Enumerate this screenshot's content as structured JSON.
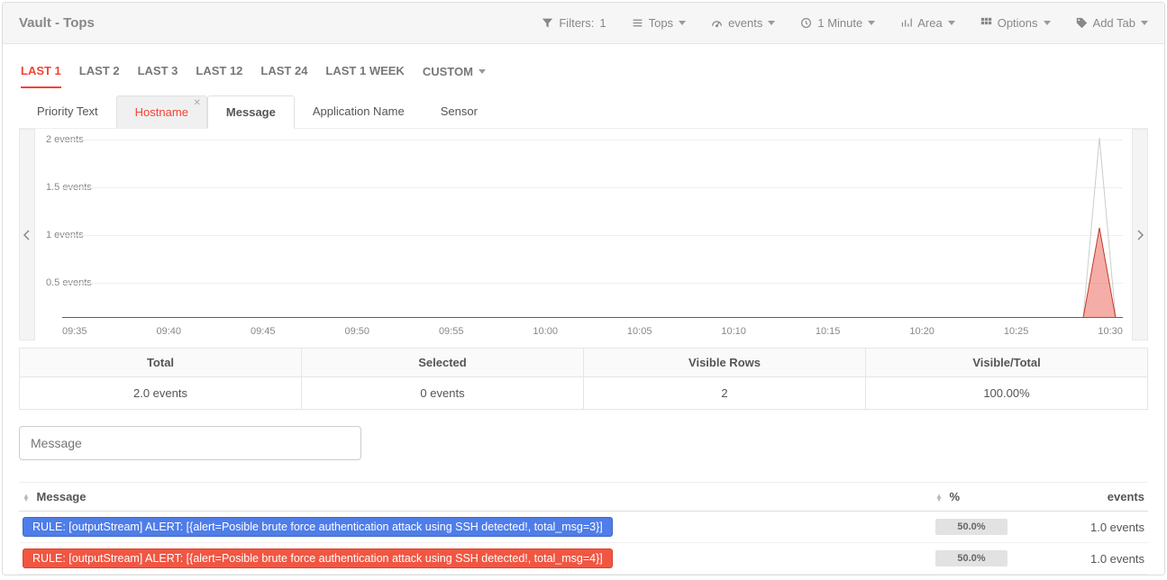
{
  "header": {
    "title": "Vault - Tops",
    "toolbar": {
      "filters": {
        "label": "Filters:",
        "count": "1"
      },
      "tops": "Tops",
      "events": "events",
      "interval": "1 Minute",
      "chart_type": "Area",
      "options": "Options",
      "add_tab": "Add Tab"
    }
  },
  "time_tabs": [
    "LAST 1",
    "LAST 2",
    "LAST 3",
    "LAST 12",
    "LAST 24",
    "LAST 1 WEEK",
    "CUSTOM"
  ],
  "time_tabs_active": "LAST 1",
  "field_tabs": {
    "priority": "Priority Text",
    "hostname": "Hostname",
    "message": "Message",
    "app": "Application Name",
    "sensor": "Sensor"
  },
  "chart_data": {
    "type": "area",
    "title": "",
    "xlabel": "",
    "ylabel": "events",
    "ylim": [
      0,
      2
    ],
    "y_ticks": [
      "2 events",
      "1.5 events",
      "1 events",
      "0.5 events"
    ],
    "x_ticks": [
      "09:35",
      "09:40",
      "09:45",
      "09:50",
      "09:55",
      "10:00",
      "10:05",
      "10:10",
      "10:15",
      "10:20",
      "10:25",
      "10:30"
    ],
    "series": [
      {
        "name": "total",
        "values": [
          0,
          0,
          0,
          0,
          0,
          0,
          0,
          0,
          0,
          0,
          0,
          2
        ],
        "color": "#cccccc"
      },
      {
        "name": "selected",
        "values": [
          0,
          0,
          0,
          0,
          0,
          0,
          0,
          0,
          0,
          0,
          0,
          1
        ],
        "color": "#e74c3c"
      }
    ]
  },
  "stats": {
    "headers": {
      "total": "Total",
      "selected": "Selected",
      "visible_rows": "Visible Rows",
      "visible_total": "Visible/Total"
    },
    "values": {
      "total": "2.0 events",
      "selected": "0 events",
      "visible_rows": "2",
      "visible_total": "100.00%"
    }
  },
  "filter": {
    "placeholder": "Message"
  },
  "table": {
    "columns": {
      "message": "Message",
      "pct": "%",
      "events": "events"
    },
    "rows": [
      {
        "msg": "RULE: [outputStream] ALERT: [{alert=Posible brute force authentication attack using SSH detected!, total_msg=3}]",
        "pct": "50.0%",
        "events": "1.0 events",
        "color": "blue"
      },
      {
        "msg": "RULE: [outputStream] ALERT: [{alert=Posible brute force authentication attack using SSH detected!, total_msg=4}]",
        "pct": "50.0%",
        "events": "1.0 events",
        "color": "red"
      }
    ]
  }
}
